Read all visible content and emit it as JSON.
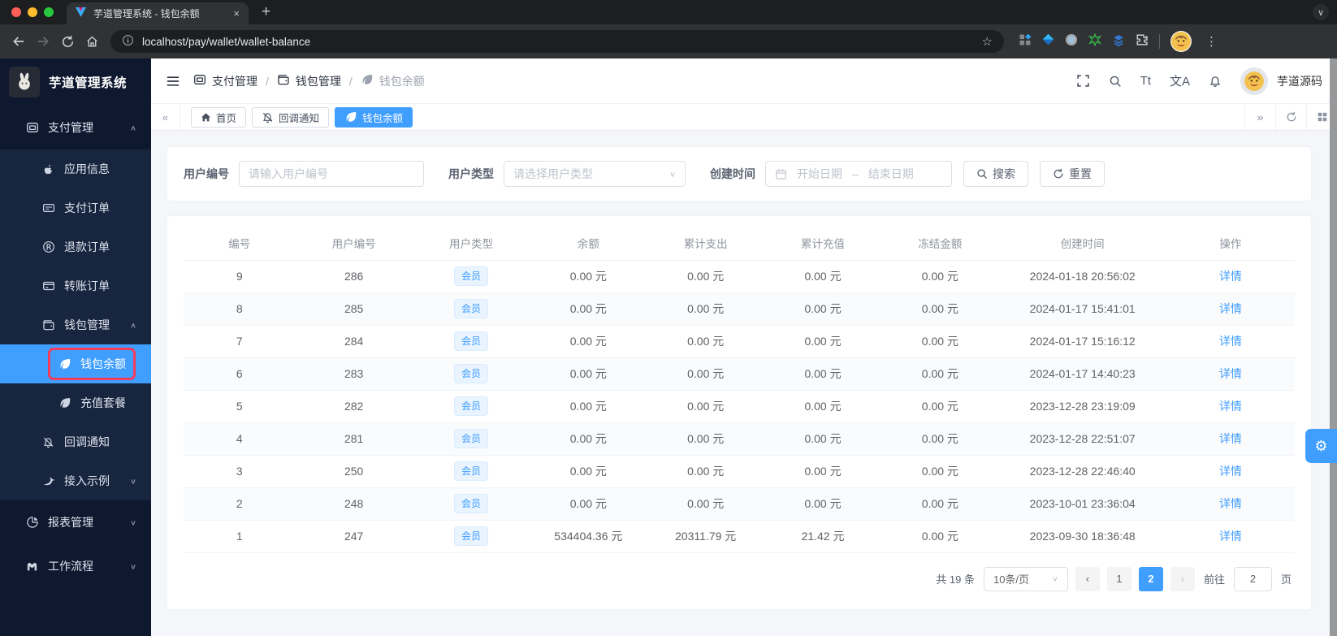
{
  "browser": {
    "tab_title": "芋道管理系统 - 钱包余额",
    "close_glyph": "×",
    "new_tab_glyph": "+",
    "url": "localhost/pay/wallet/wallet-balance",
    "kebab_glyph": "⋮",
    "star_glyph": "☆",
    "tab_search_glyph": "∨"
  },
  "sidebar": {
    "logo_title": "芋道管理系统",
    "menu": [
      {
        "label": "支付管理",
        "icon": "payment",
        "level": 0,
        "chevron": "up"
      },
      {
        "label": "应用信息",
        "icon": "apple",
        "level": 1
      },
      {
        "label": "支付订单",
        "icon": "paypal",
        "level": 1
      },
      {
        "label": "退款订单",
        "icon": "refund",
        "level": 1
      },
      {
        "label": "转账订单",
        "icon": "transfer",
        "level": 1
      },
      {
        "label": "钱包管理",
        "icon": "wallet",
        "level": 1,
        "chevron": "up"
      },
      {
        "label": "钱包余额",
        "icon": "leaf",
        "level": 2,
        "active": true,
        "annotated": true
      },
      {
        "label": "充值套餐",
        "icon": "leaf",
        "level": 2
      },
      {
        "label": "回调通知",
        "icon": "bell-off",
        "level": 1
      },
      {
        "label": "接入示例",
        "icon": "bird",
        "level": 1,
        "chevron": "down"
      },
      {
        "label": "报表管理",
        "icon": "chart-pie",
        "level": 0,
        "chevron": "down"
      },
      {
        "label": "工作流程",
        "icon": "workflow",
        "level": 0,
        "chevron": "down"
      }
    ]
  },
  "header": {
    "breadcrumb": [
      {
        "label": "支付管理",
        "icon": "payment"
      },
      {
        "label": "钱包管理",
        "icon": "wallet"
      },
      {
        "label": "钱包余额",
        "icon": "leaf"
      }
    ],
    "separator": "/",
    "font_size_label": "Tt",
    "translate_label": "文A",
    "user_name": "芋道源码"
  },
  "tagbar": {
    "left_glyph": "«",
    "right_glyph": "»",
    "tabs": [
      {
        "label": "首页",
        "icon": "home"
      },
      {
        "label": "回调通知",
        "icon": "bell-off"
      },
      {
        "label": "钱包余额",
        "icon": "leaf",
        "active": true
      }
    ]
  },
  "filters": {
    "user_id_label": "用户编号",
    "user_id_placeholder": "请输入用户编号",
    "user_type_label": "用户类型",
    "user_type_placeholder": "请选择用户类型",
    "create_time_label": "创建时间",
    "date_start_placeholder": "开始日期",
    "date_separator": "–",
    "date_end_placeholder": "结束日期",
    "search_label": "搜索",
    "reset_label": "重置"
  },
  "table": {
    "columns": [
      "编号",
      "用户编号",
      "用户类型",
      "余额",
      "累计支出",
      "累计充值",
      "冻结金额",
      "创建时间",
      "操作"
    ],
    "rows": [
      {
        "id": "9",
        "user_id": "286",
        "type": "会员",
        "balance": "0.00 元",
        "expense": "0.00 元",
        "recharge": "0.00 元",
        "frozen": "0.00 元",
        "created": "2024-01-18 20:56:02",
        "action": "详情"
      },
      {
        "id": "8",
        "user_id": "285",
        "type": "会员",
        "balance": "0.00 元",
        "expense": "0.00 元",
        "recharge": "0.00 元",
        "frozen": "0.00 元",
        "created": "2024-01-17 15:41:01",
        "action": "详情"
      },
      {
        "id": "7",
        "user_id": "284",
        "type": "会员",
        "balance": "0.00 元",
        "expense": "0.00 元",
        "recharge": "0.00 元",
        "frozen": "0.00 元",
        "created": "2024-01-17 15:16:12",
        "action": "详情"
      },
      {
        "id": "6",
        "user_id": "283",
        "type": "会员",
        "balance": "0.00 元",
        "expense": "0.00 元",
        "recharge": "0.00 元",
        "frozen": "0.00 元",
        "created": "2024-01-17 14:40:23",
        "action": "详情"
      },
      {
        "id": "5",
        "user_id": "282",
        "type": "会员",
        "balance": "0.00 元",
        "expense": "0.00 元",
        "recharge": "0.00 元",
        "frozen": "0.00 元",
        "created": "2023-12-28 23:19:09",
        "action": "详情"
      },
      {
        "id": "4",
        "user_id": "281",
        "type": "会员",
        "balance": "0.00 元",
        "expense": "0.00 元",
        "recharge": "0.00 元",
        "frozen": "0.00 元",
        "created": "2023-12-28 22:51:07",
        "action": "详情"
      },
      {
        "id": "3",
        "user_id": "250",
        "type": "会员",
        "balance": "0.00 元",
        "expense": "0.00 元",
        "recharge": "0.00 元",
        "frozen": "0.00 元",
        "created": "2023-12-28 22:46:40",
        "action": "详情"
      },
      {
        "id": "2",
        "user_id": "248",
        "type": "会员",
        "balance": "0.00 元",
        "expense": "0.00 元",
        "recharge": "0.00 元",
        "frozen": "0.00 元",
        "created": "2023-10-01 23:36:04",
        "action": "详情"
      },
      {
        "id": "1",
        "user_id": "247",
        "type": "会员",
        "balance": "534404.36 元",
        "expense": "20311.79 元",
        "recharge": "21.42 元",
        "frozen": "0.00 元",
        "created": "2023-09-30 18:36:48",
        "action": "详情"
      }
    ]
  },
  "pagination": {
    "total": "共 19 条",
    "page_size": "10条/页",
    "prev_glyph": "‹",
    "page_1": "1",
    "page_2": "2",
    "next_glyph": "›",
    "goto_label": "前往",
    "goto_value": "2",
    "page_unit": "页"
  },
  "colors": {
    "accent": "#409eff",
    "annotation": "#f23c5d",
    "sidebar_bg": "#0e1930",
    "sidebar_sub_bg": "#17253f"
  }
}
